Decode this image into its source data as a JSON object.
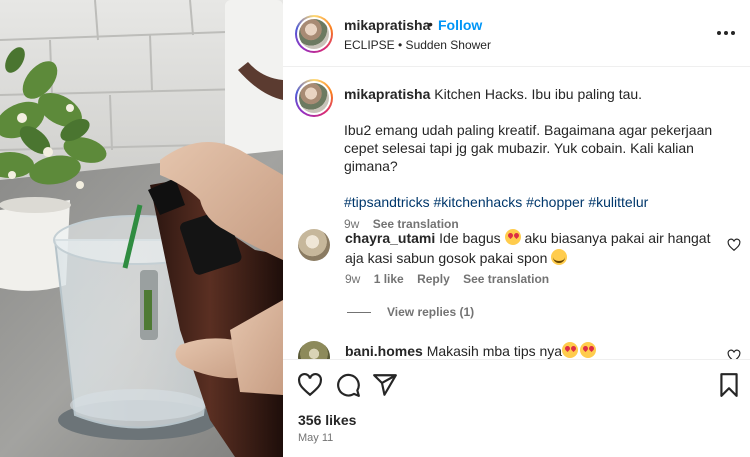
{
  "post": {
    "username": "mikapratisha",
    "follow_label": "Follow",
    "separator": "•",
    "audio": "ECLIPSE • Sudden Shower"
  },
  "caption": {
    "username": "mikapratisha",
    "line1": "Kitchen Hacks. Ibu ibu paling tau.",
    "paragraph2": "Ibu2 emang udah paling kreatif. Bagaimana agar pekerjaan cepet selesai tapi jg gak mubazir. Yuk cobain. Kali kalian gimana?",
    "hashtags": "#tipsandtricks #kitchenhacks #chopper #kulittelur",
    "age": "9w",
    "see_translation": "See translation"
  },
  "comments": [
    {
      "username": "chayra_utami",
      "text_part1": "Ide bagus",
      "emoji1": "heart-eyes",
      "text_part2": "aku biasanya pakai air hangat aja kasi sabun gosok pakai spon",
      "emoji2": "blush",
      "age": "9w",
      "likes": "1 like",
      "reply": "Reply",
      "see_translation": "See translation",
      "view_replies": "View replies (1)"
    },
    {
      "username": "bani.homes",
      "text": "Makasih mba tips nya",
      "emoji1": "heart-eyes",
      "emoji2": "heart-eyes"
    }
  ],
  "footer": {
    "likes": "356 likes",
    "date": "May 11"
  },
  "icons": {
    "like": "heart-icon",
    "comment": "comment-icon",
    "share": "send-icon",
    "save": "bookmark-icon",
    "more": "more-horizontal-icon"
  },
  "colors": {
    "accent": "#0095f6",
    "hashtag": "#00376b",
    "muted": "#737373",
    "text": "#262626"
  }
}
